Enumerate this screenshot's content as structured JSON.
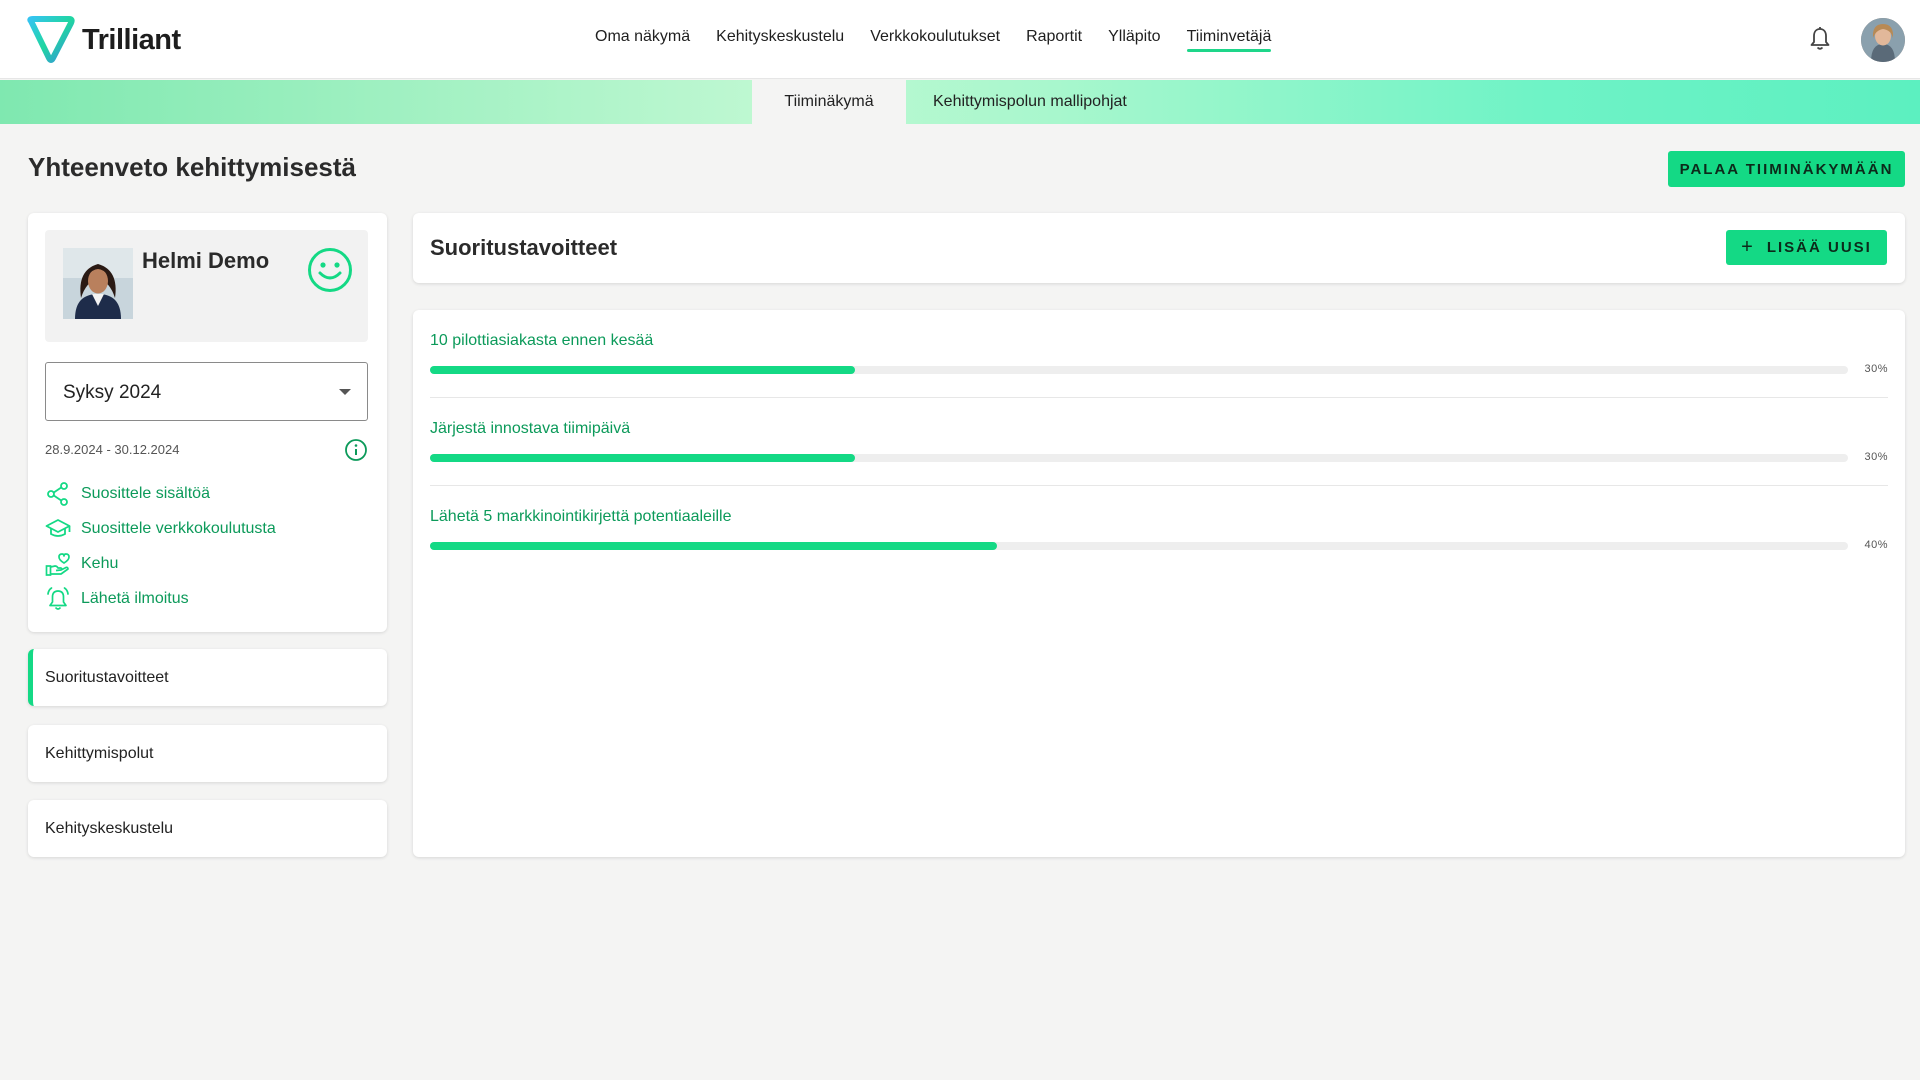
{
  "app": {
    "brand": "Trilliant"
  },
  "nav": {
    "items": [
      "Oma näkymä",
      "Kehityskeskustelu",
      "Verkkokoulutukset",
      "Raportit",
      "Ylläpito",
      "Tiiminvetäjä"
    ],
    "active": "Tiiminvetäjä"
  },
  "subtabs": {
    "items": [
      "Tiiminäkymä",
      "Kehittymispolun mallipohjat"
    ],
    "active": "Tiiminäkymä"
  },
  "page": {
    "title": "Yhteenveto kehittymisestä",
    "back_button": "PALAA TIIMINÄKYMÄÄN"
  },
  "profile": {
    "name": "Helmi Demo",
    "mood_icon": "smiley-icon",
    "period": "Syksy 2024",
    "date_range": "28.9.2024 - 30.12.2024",
    "actions": [
      {
        "label": "Suosittele sisältöä",
        "icon": "share-icon"
      },
      {
        "label": "Suosittele verkkokoulutusta",
        "icon": "graduation-cap-icon"
      },
      {
        "label": "Kehu",
        "icon": "hand-heart-icon"
      },
      {
        "label": "Lähetä ilmoitus",
        "icon": "alarm-bell-icon"
      }
    ]
  },
  "side_menu": {
    "items": [
      "Suoritustavoitteet",
      "Kehittymispolut",
      "Kehityskeskustelu"
    ],
    "active": "Suoritustavoitteet"
  },
  "goals": {
    "title": "Suoritustavoitteet",
    "add_button": "LISÄÄ UUSI",
    "items": [
      {
        "title": "10 pilottiasiakasta ennen kesää",
        "progress": 0.3,
        "progress_label": "30%"
      },
      {
        "title": "Järjestä innostava tiimipäivä",
        "progress": 0.3,
        "progress_label": "30%"
      },
      {
        "title": "Lähetä 5 markkinointikirjettä potentiaaleille",
        "progress": 0.4,
        "progress_label": "40%"
      }
    ]
  },
  "colors": {
    "accent": "#14d985",
    "link": "#0c9a5a"
  }
}
